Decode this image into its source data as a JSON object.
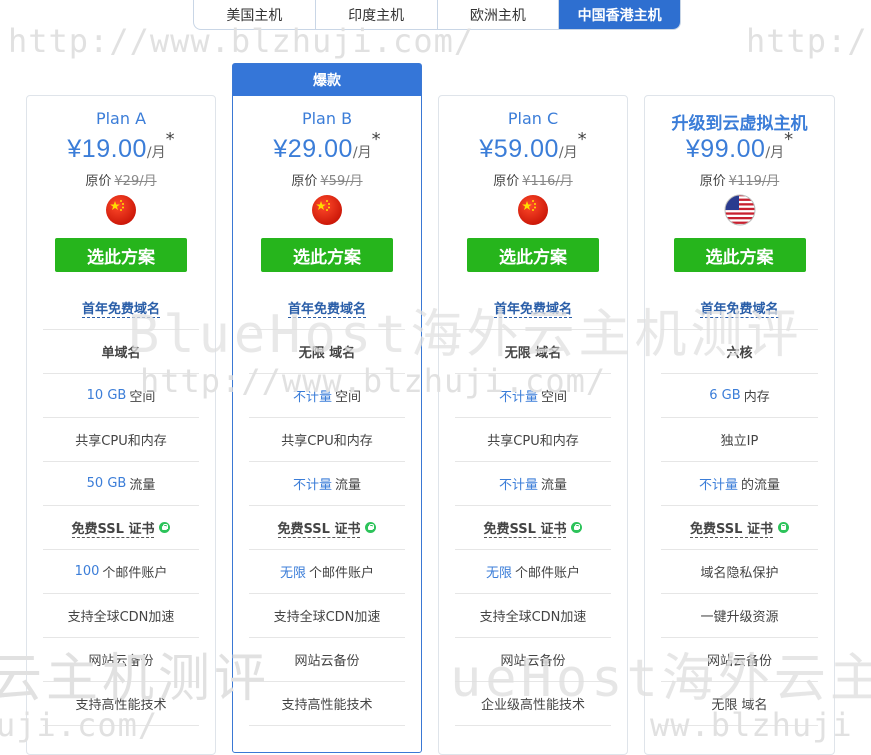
{
  "tabs": [
    "美国主机",
    "印度主机",
    "欧洲主机",
    "中国香港主机"
  ],
  "active_tab": 3,
  "watermark": {
    "url": "http://www.blzhuji.com/",
    "brand": "BlueHost海外云主机测评",
    "partial_left": "云主机测评",
    "partial_left2": "uji.com/",
    "partial_right": "ueHost海外云主",
    "partial_right2": "ww.blzhuji"
  },
  "plans": [
    {
      "name": "Plan A",
      "price": "¥19.00",
      "unit": "/月",
      "star": "*",
      "orig_label": "原价",
      "orig_price": "¥29/月",
      "flag": "china-flag-icon",
      "button": "选此方案",
      "features": [
        {
          "parts": [
            {
              "t": "首年免费域名",
              "s": "blue-u"
            }
          ]
        },
        {
          "parts": [
            {
              "t": "单域名",
              "s": "bold"
            }
          ]
        },
        {
          "parts": [
            {
              "t": "10 GB",
              "s": "hl"
            },
            {
              "t": "空间"
            }
          ]
        },
        {
          "parts": [
            {
              "t": "共享CPU和内存"
            }
          ]
        },
        {
          "parts": [
            {
              "t": "50 GB",
              "s": "hl"
            },
            {
              "t": "流量"
            }
          ]
        },
        {
          "parts": [
            {
              "t": "免费SSL 证书",
              "s": "u"
            }
          ],
          "lock": true
        },
        {
          "parts": [
            {
              "t": "100",
              "s": "hl"
            },
            {
              "t": "个邮件账户"
            }
          ]
        },
        {
          "parts": [
            {
              "t": "支持全球CDN加速"
            }
          ]
        },
        {
          "parts": [
            {
              "t": "网站云备份"
            }
          ]
        },
        {
          "parts": [
            {
              "t": "支持高性能技术"
            }
          ]
        }
      ]
    },
    {
      "hot": "爆款",
      "name": "Plan B",
      "price": "¥29.00",
      "unit": "/月",
      "star": "*",
      "orig_label": "原价",
      "orig_price": "¥59/月",
      "flag": "china-flag-icon",
      "button": "选此方案",
      "features": [
        {
          "parts": [
            {
              "t": "首年免费域名",
              "s": "blue-u"
            }
          ]
        },
        {
          "parts": [
            {
              "t": "无限 域名",
              "s": "bold"
            }
          ]
        },
        {
          "parts": [
            {
              "t": "不计量",
              "s": "hl"
            },
            {
              "t": "空间"
            }
          ]
        },
        {
          "parts": [
            {
              "t": "共享CPU和内存"
            }
          ]
        },
        {
          "parts": [
            {
              "t": "不计量",
              "s": "hl"
            },
            {
              "t": "流量"
            }
          ]
        },
        {
          "parts": [
            {
              "t": "免费SSL 证书",
              "s": "u"
            }
          ],
          "lock": true
        },
        {
          "parts": [
            {
              "t": "无限",
              "s": "hl"
            },
            {
              "t": "个邮件账户"
            }
          ]
        },
        {
          "parts": [
            {
              "t": "支持全球CDN加速"
            }
          ]
        },
        {
          "parts": [
            {
              "t": "网站云备份"
            }
          ]
        },
        {
          "parts": [
            {
              "t": "支持高性能技术"
            }
          ]
        }
      ]
    },
    {
      "name": "Plan C",
      "price": "¥59.00",
      "unit": "/月",
      "star": "*",
      "orig_label": "原价",
      "orig_price": "¥116/月",
      "flag": "china-flag-icon",
      "button": "选此方案",
      "features": [
        {
          "parts": [
            {
              "t": "首年免费域名",
              "s": "blue-u"
            }
          ]
        },
        {
          "parts": [
            {
              "t": "无限 域名",
              "s": "bold"
            }
          ]
        },
        {
          "parts": [
            {
              "t": "不计量",
              "s": "hl"
            },
            {
              "t": "空间"
            }
          ]
        },
        {
          "parts": [
            {
              "t": "共享CPU和内存"
            }
          ]
        },
        {
          "parts": [
            {
              "t": "不计量",
              "s": "hl"
            },
            {
              "t": "流量"
            }
          ]
        },
        {
          "parts": [
            {
              "t": "免费SSL 证书",
              "s": "u"
            }
          ],
          "lock": true
        },
        {
          "parts": [
            {
              "t": "无限",
              "s": "hl"
            },
            {
              "t": "个邮件账户"
            }
          ]
        },
        {
          "parts": [
            {
              "t": "支持全球CDN加速"
            }
          ]
        },
        {
          "parts": [
            {
              "t": "网站云备份"
            }
          ]
        },
        {
          "parts": [
            {
              "t": "企业级高性能技术"
            }
          ]
        }
      ]
    },
    {
      "name": "升级到云虚拟主机",
      "name_bold": true,
      "price": "¥99.00",
      "unit": "/月",
      "star": "*",
      "orig_label": "原价",
      "orig_price": "¥119/月",
      "flag": "usa-flag-icon",
      "button": "选此方案",
      "features": [
        {
          "parts": [
            {
              "t": "首年免费域名",
              "s": "blue-u"
            }
          ]
        },
        {
          "parts": [
            {
              "t": "六核",
              "s": "bold"
            }
          ]
        },
        {
          "parts": [
            {
              "t": "6 GB",
              "s": "hl"
            },
            {
              "t": "内存"
            }
          ]
        },
        {
          "parts": [
            {
              "t": "独立IP"
            }
          ]
        },
        {
          "parts": [
            {
              "t": "不计量",
              "s": "hl"
            },
            {
              "t": "的流量"
            }
          ]
        },
        {
          "parts": [
            {
              "t": "免费SSL 证书",
              "s": "u"
            }
          ],
          "lock": true
        },
        {
          "parts": [
            {
              "t": "域名隐私保护"
            }
          ]
        },
        {
          "parts": [
            {
              "t": "一键升级资源"
            }
          ]
        },
        {
          "parts": [
            {
              "t": "网站云备份"
            }
          ]
        },
        {
          "parts": [
            {
              "t": "无限 域名"
            }
          ]
        }
      ]
    }
  ]
}
